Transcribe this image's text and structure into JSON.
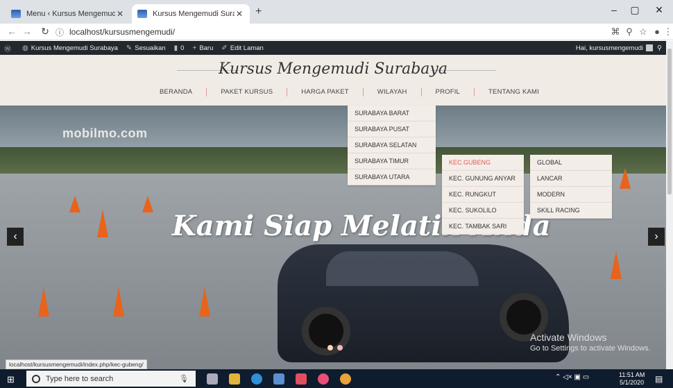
{
  "browser": {
    "tabs": [
      {
        "title": "Menu ‹ Kursus Mengemudi Surab",
        "active": false
      },
      {
        "title": "Kursus Mengemudi Surabaya",
        "active": true
      }
    ],
    "url": "localhost/kursusmengemudi/"
  },
  "adminbar": {
    "site_name": "Kursus Mengemudi Surabaya",
    "customize": "Sesuaikan",
    "comments_count": "0",
    "new": "Baru",
    "edit": "Edit Laman",
    "greeting": "Hai, kursusmengemudi"
  },
  "site": {
    "title": "Kursus Mengemudi Surabaya",
    "nav": [
      "BERANDA",
      "PAKET KURSUS",
      "HARGA PAKET",
      "WILAYAH",
      "PROFIL",
      "TENTANG KAMI"
    ]
  },
  "menu": {
    "wilayah": [
      "SURABAYA BARAT",
      "SURABAYA PUSAT",
      "SURABAYA SELATAN",
      "SURABAYA TIMUR",
      "SURABAYA UTARA"
    ],
    "timur": [
      "KEC.GUBENG",
      "KEC. GUNUNG ANYAR",
      "KEC. RUNGKUT",
      "KEC. SUKOLILO",
      "KEC. TAMBAK SARI"
    ],
    "gubeng": [
      "GLOBAL",
      "LANCAR",
      "MODERN",
      "SKILL RACING"
    ]
  },
  "hero": {
    "watermark": "mobilmo.com",
    "slogan": "Kami Siap Melatih Anda"
  },
  "activate": {
    "line1": "Activate Windows",
    "line2": "Go to Settings to activate Windows."
  },
  "status_url": "localhost/kursusmengemudi/index.php/kec-gubeng/",
  "taskbar": {
    "search_placeholder": "Type here to search",
    "time": "11:51 AM",
    "date": "5/1/2020"
  }
}
